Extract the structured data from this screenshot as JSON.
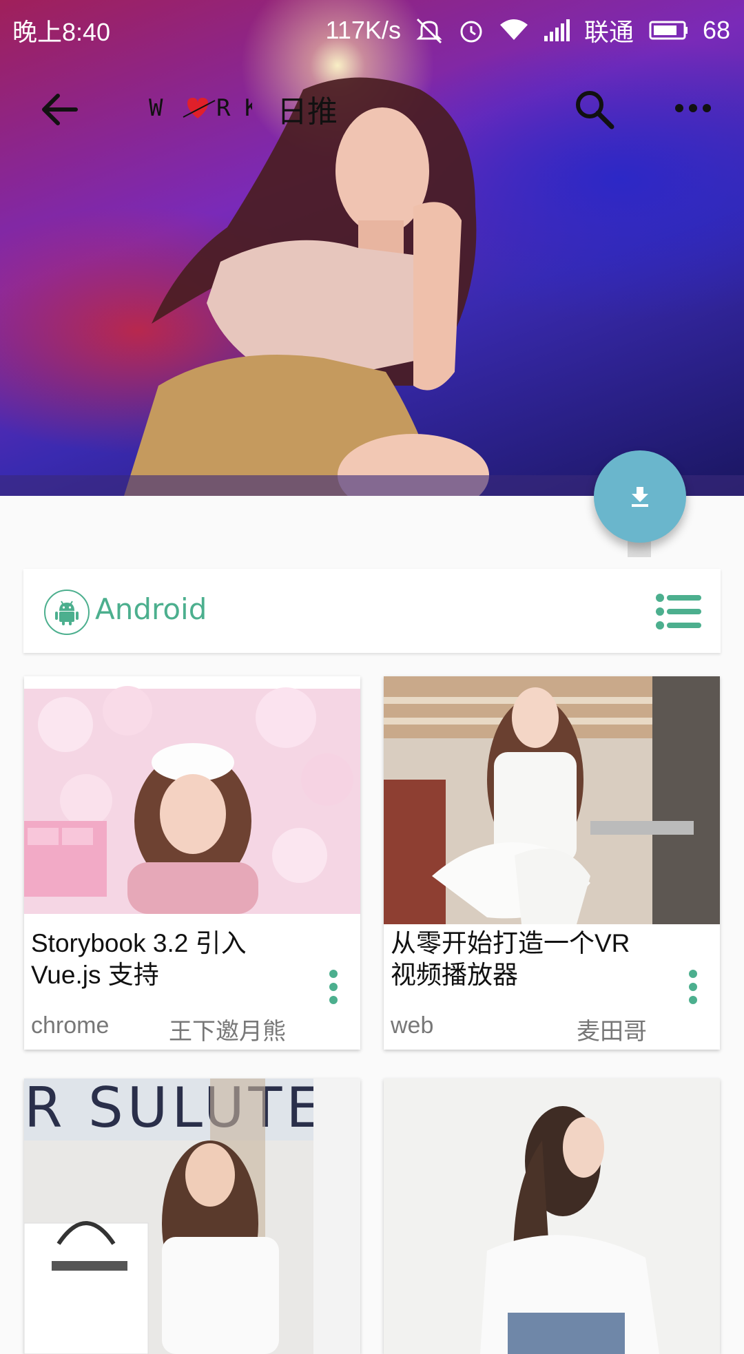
{
  "status_bar": {
    "time": "晚上8:40",
    "speed": "117K/s",
    "carrier": "联通",
    "battery": "68"
  },
  "toolbar": {
    "logo_text": "W♥RK",
    "title": "日推"
  },
  "category": {
    "label": "Android",
    "accent": "#4caf8e"
  },
  "cards": [
    {
      "title_line1": "Storybook 3.2 引入",
      "title_line2": "Vue.js 支持",
      "source": "chrome",
      "author": "王下邀月熊"
    },
    {
      "title_line1": "从零开始打造一个VR",
      "title_line2": "视频播放器",
      "source": "web",
      "author": "麦田哥"
    }
  ],
  "colors": {
    "fab": "#6ab6cc",
    "menu_dots": "#4caf8e"
  }
}
